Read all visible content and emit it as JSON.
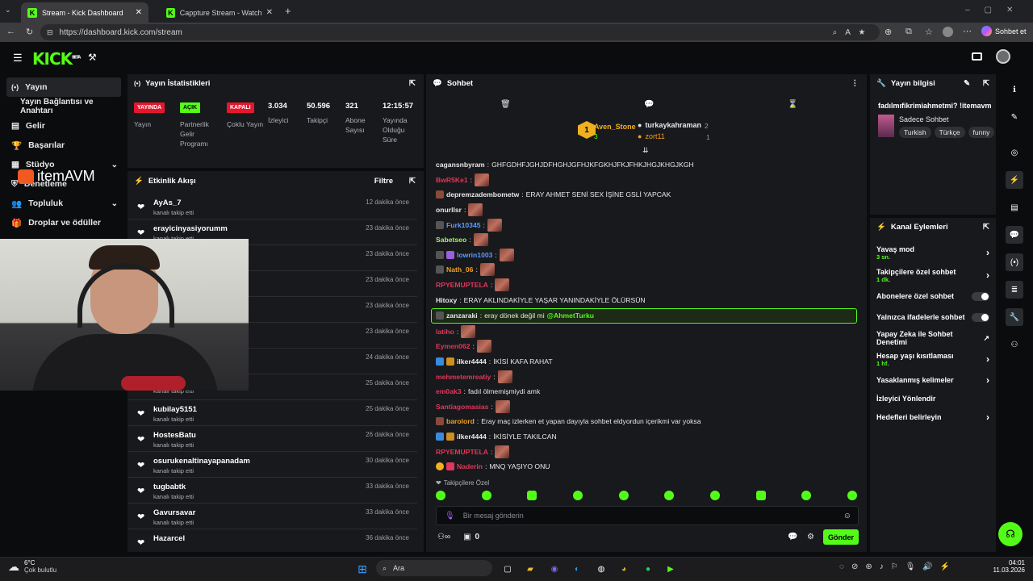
{
  "browser": {
    "tabs": [
      {
        "title": "Stream - Kick Dashboard"
      },
      {
        "title": "Cappture Stream - Watch Live on K"
      }
    ],
    "url": "https://dashboard.kick.com/stream",
    "profile_label": "Sohbet et"
  },
  "header": {
    "logo": "KICK",
    "beta": "BETA"
  },
  "sidebar": {
    "items": [
      {
        "label": "Yayın"
      },
      {
        "label": "Yayın Bağlantısı ve Anahtarı"
      },
      {
        "label": "Gelir"
      },
      {
        "label": "Başarılar"
      },
      {
        "label": "Stüdyo"
      },
      {
        "label": "Denetleme"
      },
      {
        "label": "Topluluk"
      },
      {
        "label": "Droplar ve ödüller"
      }
    ]
  },
  "overlay": {
    "logo_text": "itemAVM"
  },
  "stats": {
    "title": "Yayın İstatistikleri",
    "items": [
      {
        "badge": "YAYINDA",
        "badge_color": "#e6172d",
        "label": "Yayın"
      },
      {
        "badge": "AÇIK",
        "badge_color": "#53fc18",
        "label": "Partnerlik Gelir Programı"
      },
      {
        "badge": "KAPALI",
        "badge_color": "#e6172d",
        "label": "Çoklu Yayın"
      },
      {
        "value": "3.034",
        "label": "İzleyici"
      },
      {
        "value": "50.596",
        "label": "Takipçi"
      },
      {
        "value": "321",
        "label": "Abone Sayısı"
      },
      {
        "value": "12:15:57",
        "label": "Yayında Olduğu Süre"
      }
    ]
  },
  "activity": {
    "title": "Etkinlik Akışı",
    "filter": "Filtre",
    "rows": [
      {
        "name": "AyAs_7",
        "sub": "kanalı takip etti",
        "time": "12 dakika önce"
      },
      {
        "name": "erayicinyasiyorumm",
        "sub": "kanalı takip etti",
        "time": "23 dakika önce"
      },
      {
        "name": "",
        "sub": "",
        "time": "23 dakika önce"
      },
      {
        "name": "",
        "sub": "",
        "time": "23 dakika önce"
      },
      {
        "name": "",
        "sub": "",
        "time": "23 dakika önce"
      },
      {
        "name": "",
        "sub": "",
        "time": "23 dakika önce"
      },
      {
        "name": "",
        "sub": "",
        "time": "24 dakika önce"
      },
      {
        "name": "",
        "sub": "kanalı takip etti",
        "time": "25 dakika önce"
      },
      {
        "name": "kubilay5151",
        "sub": "kanalı takip etti",
        "time": "25 dakika önce"
      },
      {
        "name": "HostesBatu",
        "sub": "kanalı takip etti",
        "time": "26 dakika önce"
      },
      {
        "name": "osurukenaltinayapanadam",
        "sub": "kanalı takip etti",
        "time": "30 dakika önce"
      },
      {
        "name": "tugbabtk",
        "sub": "kanalı takip etti",
        "time": "33 dakika önce"
      },
      {
        "name": "Gavursavar",
        "sub": "kanalı takip etti",
        "time": "33 dakika önce"
      },
      {
        "name": "Hazarcel",
        "sub": "",
        "time": "36 dakika önce"
      }
    ]
  },
  "chat": {
    "title": "Sohbet",
    "leaderboard": [
      {
        "rank": "1",
        "name": "Aven_Stone",
        "count": "3"
      },
      {
        "name": "turkaykahraman",
        "count": "2"
      },
      {
        "name": "zort11",
        "count": "1"
      }
    ],
    "messages": [
      {
        "user": "cagansnbyram",
        "color": "#e8e8e8",
        "text": "GHFGDHFJGHJDFHGHJGFHJKFGKHJFKJFHKJHGJKHGJKGH",
        "emote": false
      },
      {
        "user": "BwR5Ke1",
        "color": "#e0375b",
        "text": "",
        "emote": true
      },
      {
        "user": "depremzadembometw",
        "color": "#e8e8e8",
        "text": "ERAY AHMET SENİ SEX İŞİNE GSLİ YAPCAK",
        "emote": false
      },
      {
        "user": "onurllsr",
        "color": "#e8e8e8",
        "text": "",
        "emote": true
      },
      {
        "user": "Furk10345",
        "color": "#5b9bff",
        "text": "",
        "emote": true
      },
      {
        "user": "Sabetseo",
        "color": "#a8f070",
        "text": "",
        "emote": true
      },
      {
        "user": "lowrin1003",
        "color": "#5b9bff",
        "text": "",
        "emote": true
      },
      {
        "user": "Nath_06",
        "color": "#f0a020",
        "text": "",
        "emote": true
      },
      {
        "user": "RPYEMUPTELA",
        "color": "#e0375b",
        "text": "",
        "emote": true
      },
      {
        "user": "Hitoxy",
        "color": "#e8e8e8",
        "text": "ERAY AKLINDAKİYLE YAŞAR YANINDAKİYLE ÖLÜRSÜN",
        "emote": false
      },
      {
        "user": "zanzaraki",
        "color": "#e8e8e8",
        "text": "eray dönek değil mi",
        "mention": "@AhmetTurku",
        "highlight": true
      },
      {
        "user": "latiho",
        "color": "#e0375b",
        "text": "",
        "emote": true
      },
      {
        "user": "Eymen062",
        "color": "#e0375b",
        "text": "",
        "emote": true
      },
      {
        "user": "ilker4444",
        "color": "#e8e8e8",
        "text": "İKİSİ KAFA RAHAT",
        "emote": false
      },
      {
        "user": "mehmetemreatiy",
        "color": "#e0375b",
        "text": "",
        "emote": true
      },
      {
        "user": "em0ak3",
        "color": "#e0375b",
        "text": "fadıl ölmemişmiydi amk",
        "emote": false
      },
      {
        "user": "Santiagomasias",
        "color": "#e0375b",
        "text": "",
        "emote": true
      },
      {
        "user": "barolord",
        "color": "#f0a020",
        "text": "Eray maç izlerken et yapan dayıyla sohbet eldyordun içerikmi var yoksa",
        "emote": false
      },
      {
        "user": "ilker4444",
        "color": "#e8e8e8",
        "text": "İKİSİYLE TAKILCAN",
        "emote": false
      },
      {
        "user": "RPYEMUPTELA",
        "color": "#e0375b",
        "text": "",
        "emote": true
      },
      {
        "user": "Naderin",
        "color": "#e0375b",
        "text": "MNQ YAŞIYO ONU",
        "emote": false
      }
    ],
    "followers_only": "Takipçilere Özel",
    "input_placeholder": "Bir mesaj gönderin",
    "points": "0",
    "send_label": "Gönder"
  },
  "stream_info": {
    "title": "Yayın bilgisi",
    "stream_title": "fadılmıfikrimiahmetmi? !itemavm",
    "category": "Sadece Sohbet",
    "tags": [
      "Turkish",
      "Türkçe",
      "funny"
    ]
  },
  "channel_actions": {
    "title": "Kanal Eylemleri",
    "items": [
      {
        "label": "Yavaş mod",
        "sub": "3 sn.",
        "type": "chevron"
      },
      {
        "label": "Takipçilere özel sohbet",
        "sub": "1 dk.",
        "type": "chevron"
      },
      {
        "label": "Abonelere özel sohbet",
        "sub": "",
        "type": "toggle"
      },
      {
        "label": "Yalnızca ifadelerle sohbet",
        "sub": "",
        "type": "toggle"
      },
      {
        "label": "Yapay Zeka ile Sohbet Denetimi",
        "sub": "",
        "type": "external"
      },
      {
        "label": "Hesap yaşı kısıtlaması",
        "sub": "1 hf.",
        "type": "chevron"
      },
      {
        "label": "Yasaklanmış kelimeler",
        "sub": "",
        "type": "chevron"
      },
      {
        "label": "İzleyici Yönlendir",
        "sub": "",
        "type": "none"
      },
      {
        "label": "Hedefleri belirleyin",
        "sub": "",
        "type": "chevron"
      }
    ]
  },
  "taskbar": {
    "weather_temp": "6°C",
    "weather_desc": "Çok bulutlu",
    "search_label": "Ara",
    "time": "04:01",
    "date": "11.03.2026"
  },
  "colors": {
    "accent": "#53fc18",
    "live_red": "#e6172d",
    "panel": "#18191c",
    "bg": "#0b0c0e"
  }
}
